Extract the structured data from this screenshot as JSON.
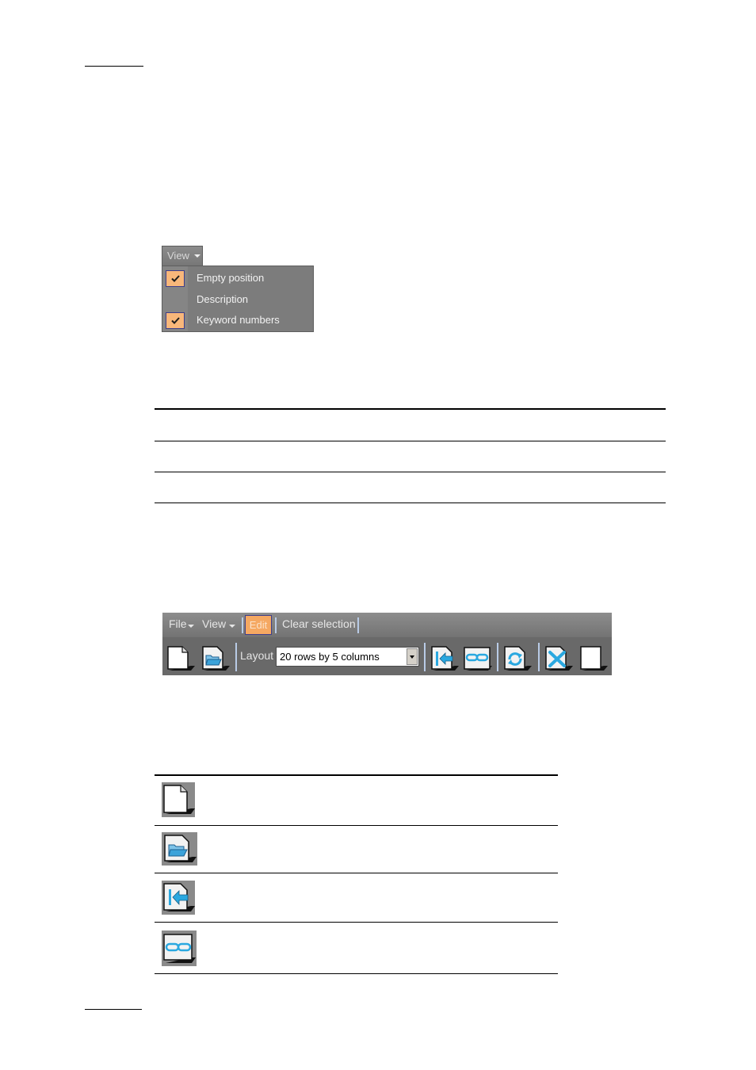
{
  "view_menu": {
    "button_label": "View",
    "items": [
      {
        "label": "Empty position",
        "checked": true
      },
      {
        "label": "Description",
        "checked": false
      },
      {
        "label": "Keyword numbers",
        "checked": true
      }
    ]
  },
  "toolbar": {
    "menus": {
      "file": "File",
      "view": "View",
      "edit": "Edit",
      "clear_selection": "Clear selection"
    },
    "layout_label": "Layout",
    "layout_value": "20 rows by 5 columns",
    "icons": [
      "new-document-icon",
      "open-folder-icon",
      "import-icon",
      "link-icon",
      "refresh-icon",
      "delete-icon",
      "blank-document-icon"
    ]
  },
  "icon_legend": {
    "rows": [
      "new-document-icon",
      "open-folder-icon",
      "import-icon",
      "link-icon"
    ]
  },
  "colors": {
    "menu_gray": "#7c7c7c",
    "check_orange": "#f8b77a",
    "icon_blue": "#2aa8e0",
    "separator_blue": "#b9cbe6"
  }
}
